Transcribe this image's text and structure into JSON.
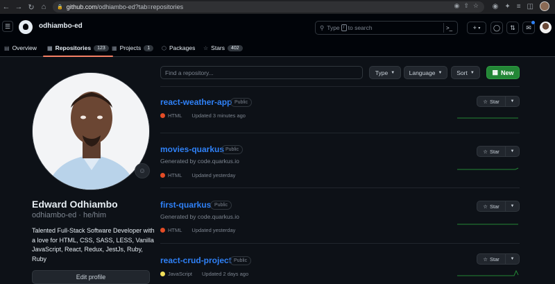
{
  "browser": {
    "url_host": "github.com",
    "url_path": "/odhiambo-ed?tab=repositories"
  },
  "header": {
    "username": "odhiambo-ed",
    "search_prefix": "Type",
    "search_key": "/",
    "search_suffix": "to search",
    "plus_label": "+"
  },
  "tabs": [
    {
      "label": "Overview",
      "icon": "book-icon",
      "count": ""
    },
    {
      "label": "Repositories",
      "icon": "repo-icon",
      "count": "123"
    },
    {
      "label": "Projects",
      "icon": "table-icon",
      "count": "1"
    },
    {
      "label": "Packages",
      "icon": "package-icon",
      "count": ""
    },
    {
      "label": "Stars",
      "icon": "star-icon",
      "count": "402"
    }
  ],
  "profile": {
    "name": "Edward Odhiambo",
    "login": "odhiambo-ed",
    "pronouns": "he/him",
    "bio": "Talented Full-Stack Software Developer with a love for HTML, CSS, SASS, LESS, Vanilla JavaScript, React, Redux, JestJs, Ruby, Ruby",
    "edit_label": "Edit profile"
  },
  "toolbar": {
    "find_placeholder": "Find a repository...",
    "type_label": "Type",
    "language_label": "Language",
    "sort_label": "Sort",
    "new_label": "New"
  },
  "repos": [
    {
      "name": "react-weather-app",
      "visibility": "Public",
      "description": "",
      "language": "HTML",
      "lang_color": "#e34c26",
      "updated": "Updated 3 minutes ago",
      "star_label": "Star"
    },
    {
      "name": "movies-quarkus",
      "visibility": "Public",
      "description": "Generated by code.quarkus.io",
      "language": "HTML",
      "lang_color": "#e34c26",
      "updated": "Updated yesterday",
      "star_label": "Star"
    },
    {
      "name": "first-quarkus",
      "visibility": "Public",
      "description": "Generated by code.quarkus.io",
      "language": "HTML",
      "lang_color": "#e34c26",
      "updated": "Updated yesterday",
      "star_label": "Star"
    },
    {
      "name": "react-crud-project",
      "visibility": "Public",
      "description": "",
      "language": "JavaScript",
      "lang_color": "#f1e05a",
      "updated": "Updated 2 days ago",
      "star_label": "Star"
    }
  ]
}
